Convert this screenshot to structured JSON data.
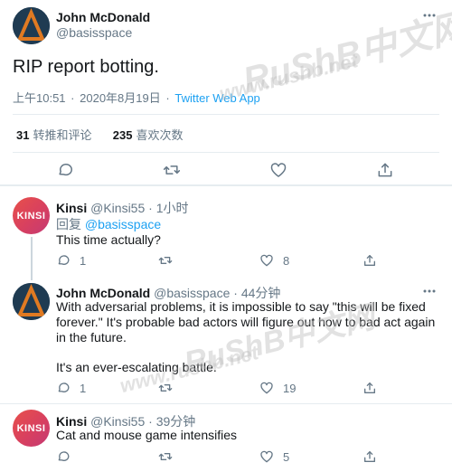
{
  "main_tweet": {
    "author_name": "John McDonald",
    "author_handle": "@basisspace",
    "text": "RIP report botting.",
    "time": "上午10:51",
    "date": "2020年8月19日",
    "separator": "·",
    "app": "Twitter Web App",
    "stats": {
      "retweets_count": "31",
      "retweets_label": "转推和评论",
      "likes_count": "235",
      "likes_label": "喜欢次数"
    }
  },
  "replies": [
    {
      "author_name": "Kinsi",
      "author_handle": "@Kinsi55",
      "separator": "·",
      "time": "1小时",
      "reply_prefix": "回复",
      "reply_to": "@basisspace",
      "text": "This time actually?",
      "reply_count": "1",
      "retweet_count": "",
      "like_count": "8",
      "avatar_text": "KINSI"
    },
    {
      "author_name": "John McDonald",
      "author_handle": "@basisspace",
      "separator": "·",
      "time": "44分钟",
      "text_lines": [
        "With adversarial problems, it is impossible to say \"this will be fixed",
        "forever.\" It's probable bad actors will figure out how to bad act again",
        "in the future."
      ],
      "text_2": "It's an ever-escalating battle.",
      "reply_count": "1",
      "retweet_count": "",
      "like_count": "19"
    },
    {
      "author_name": "Kinsi",
      "author_handle": "@Kinsi55",
      "separator": "·",
      "time": "39分钟",
      "text": "Cat and mouse game intensifies",
      "reply_count": "",
      "retweet_count": "",
      "like_count": "5",
      "avatar_text": "KINSI"
    }
  ],
  "watermarks": [
    "RuShB中文网",
    "www.rushb.net",
    "www.rushb.net",
    "RuShB中文网"
  ],
  "icons": {
    "reply": "reply-icon",
    "retweet": "retweet-icon",
    "like": "heart-icon",
    "share": "share-icon",
    "more": "more-icon"
  },
  "colors": {
    "accent": "#1da1f2",
    "muted": "#657786",
    "text": "#14171a",
    "border": "#e6ecf0"
  }
}
